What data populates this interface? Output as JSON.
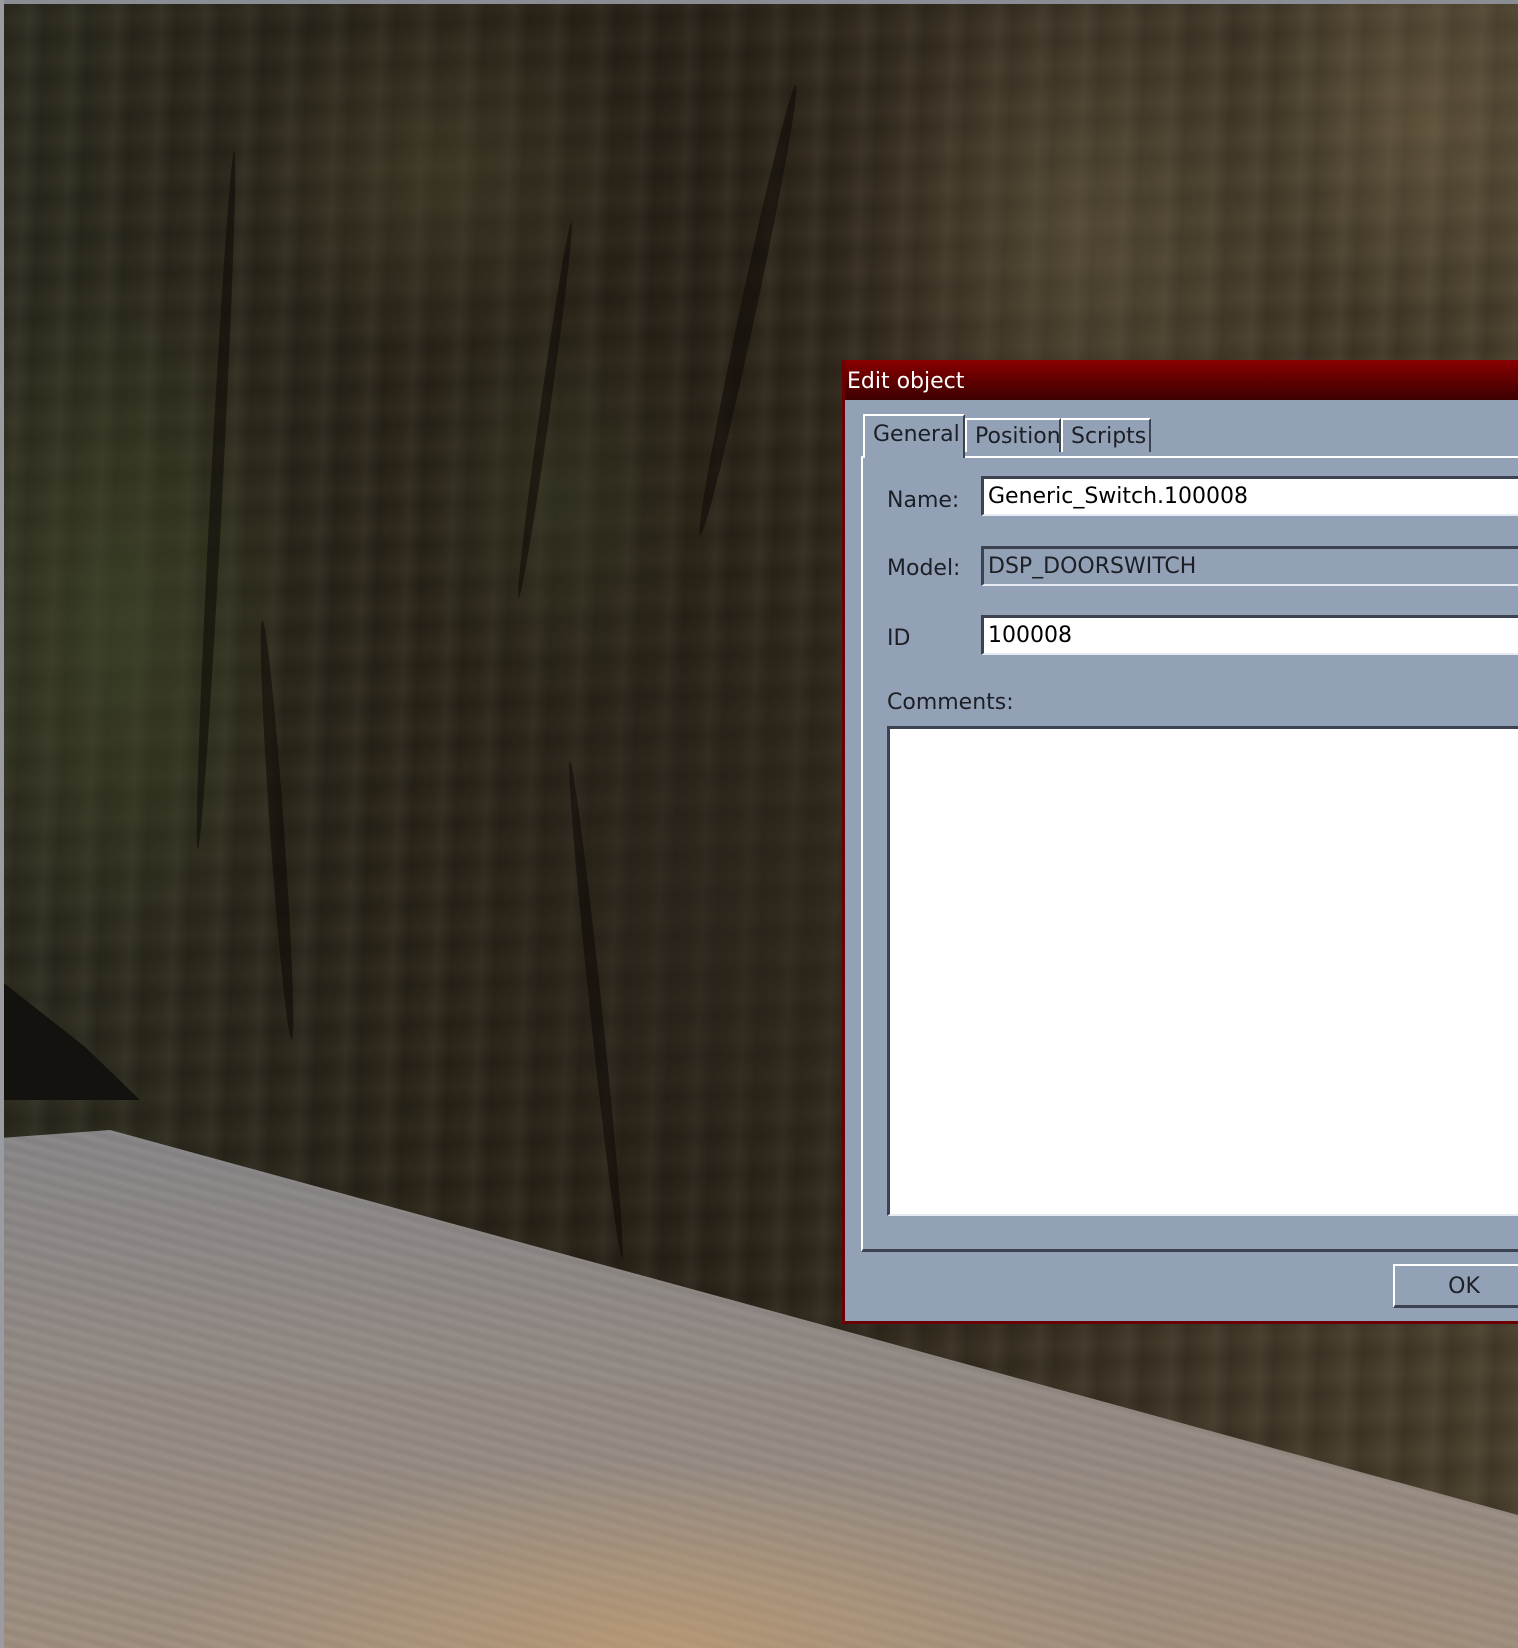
{
  "dialog": {
    "title": "Edit object",
    "tabs": [
      {
        "label": "General",
        "active": true
      },
      {
        "label": "Position",
        "active": false
      },
      {
        "label": "Scripts",
        "active": false
      }
    ],
    "fields": {
      "name": {
        "label": "Name:",
        "value": "Generic_Switch.100008"
      },
      "model": {
        "label": "Model:",
        "value": "DSP_DOORSWITCH",
        "readonly": true
      },
      "id": {
        "label": "ID",
        "value": "100008"
      },
      "comments": {
        "label": "Comments:",
        "value": ""
      }
    },
    "buttons": {
      "ok": "OK"
    }
  },
  "colors": {
    "title_bar": "#6a0000",
    "dialog_bg": "#93a1b6",
    "input_bg": "#ffffff"
  }
}
